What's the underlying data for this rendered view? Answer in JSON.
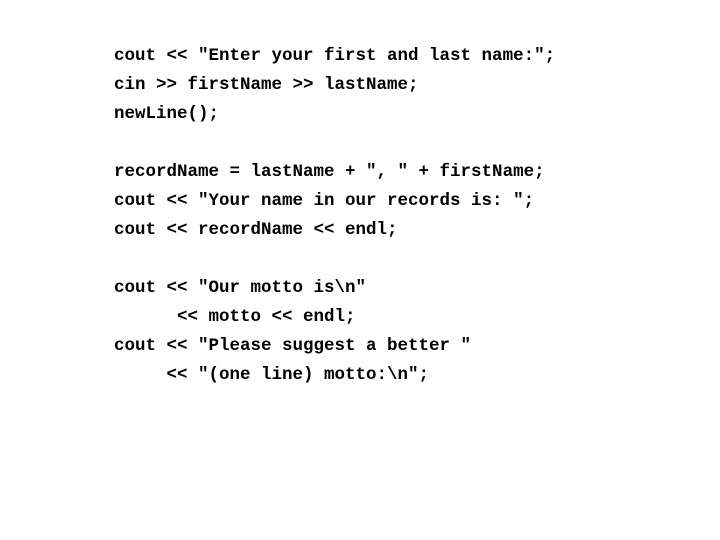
{
  "slide": {
    "background_color": "#ffffff",
    "text_color": "#000000",
    "language": "cpp",
    "code_lines": [
      {
        "id": "l1",
        "text": "cout << \"Enter your first and last name:\";"
      },
      {
        "id": "l2",
        "text": "cin >> firstName >> lastName;"
      },
      {
        "id": "l3",
        "text": "newLine();"
      },
      {
        "id": "l4",
        "text": ""
      },
      {
        "id": "l5",
        "text": "recordName = lastName + \", \" + firstName;"
      },
      {
        "id": "l6",
        "text": "cout << \"Your name in our records is: \";"
      },
      {
        "id": "l7",
        "text": "cout << recordName << endl;"
      },
      {
        "id": "l8",
        "text": ""
      },
      {
        "id": "l9",
        "text": "cout << \"Our motto is\\n\""
      },
      {
        "id": "l10",
        "text": "      << motto << endl;"
      },
      {
        "id": "l11",
        "text": "cout << \"Please suggest a better \""
      },
      {
        "id": "l12",
        "text": "     << \"(one line) motto:\\n\";"
      }
    ]
  }
}
